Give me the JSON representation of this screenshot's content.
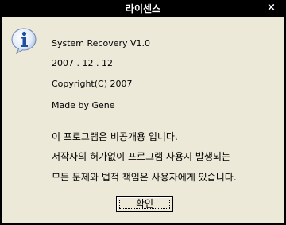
{
  "window": {
    "title": "라이센스",
    "close_label": "×"
  },
  "dialog": {
    "icon": "info-icon",
    "lines": [
      "System Recovery V1.0",
      "2007 . 12 . 12",
      "Copyright(C) 2007",
      "Made by Gene"
    ],
    "notice": [
      "이 프로그램은 비공개용 입니다.",
      "저작자의 허가없이 프로그램 사용시 발생되는",
      "모든 문제와 법적 책임은 사용자에게 있습니다."
    ],
    "ok_label": "확인"
  }
}
